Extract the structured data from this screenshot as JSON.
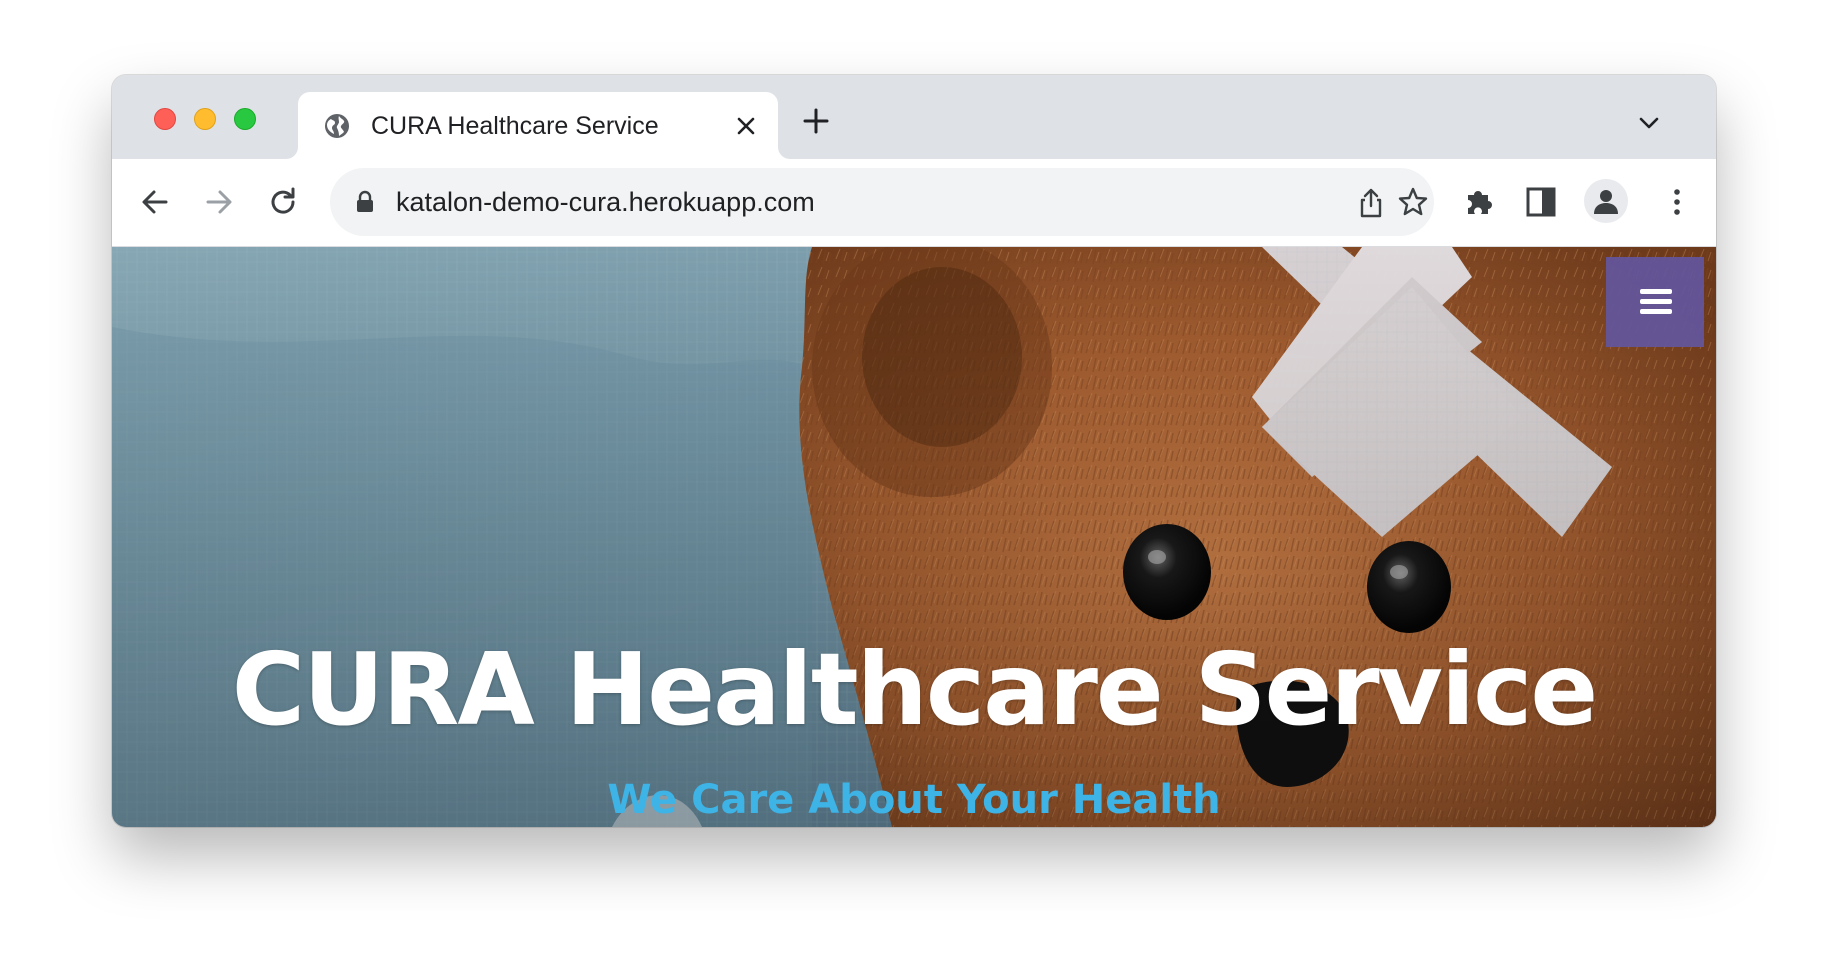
{
  "browser": {
    "tab": {
      "title": "CURA Healthcare Service",
      "favicon": "globe-icon",
      "close_icon": "close-icon"
    },
    "new_tab_icon": "plus-icon",
    "tab_search_icon": "chevron-down-icon",
    "toolbar": {
      "back_icon": "arrow-left-icon",
      "forward_icon": "arrow-right-icon",
      "reload_icon": "reload-icon",
      "url": "katalon-demo-cura.herokuapp.com",
      "lock_icon": "lock-icon",
      "share_icon": "share-icon",
      "bookmark_icon": "star-icon",
      "extensions_icon": "puzzle-icon",
      "side_panel_icon": "side-panel-icon",
      "profile_icon": "person-icon",
      "menu_icon": "kebab-menu-icon"
    }
  },
  "page": {
    "menu_toggle_icon": "hamburger-icon",
    "title": "CURA Healthcare Service",
    "subtitle": "We Care About Your Health"
  },
  "colors": {
    "menu_toggle": "#63569e",
    "subtitle": "#3db3e6",
    "title": "#ffffff"
  }
}
